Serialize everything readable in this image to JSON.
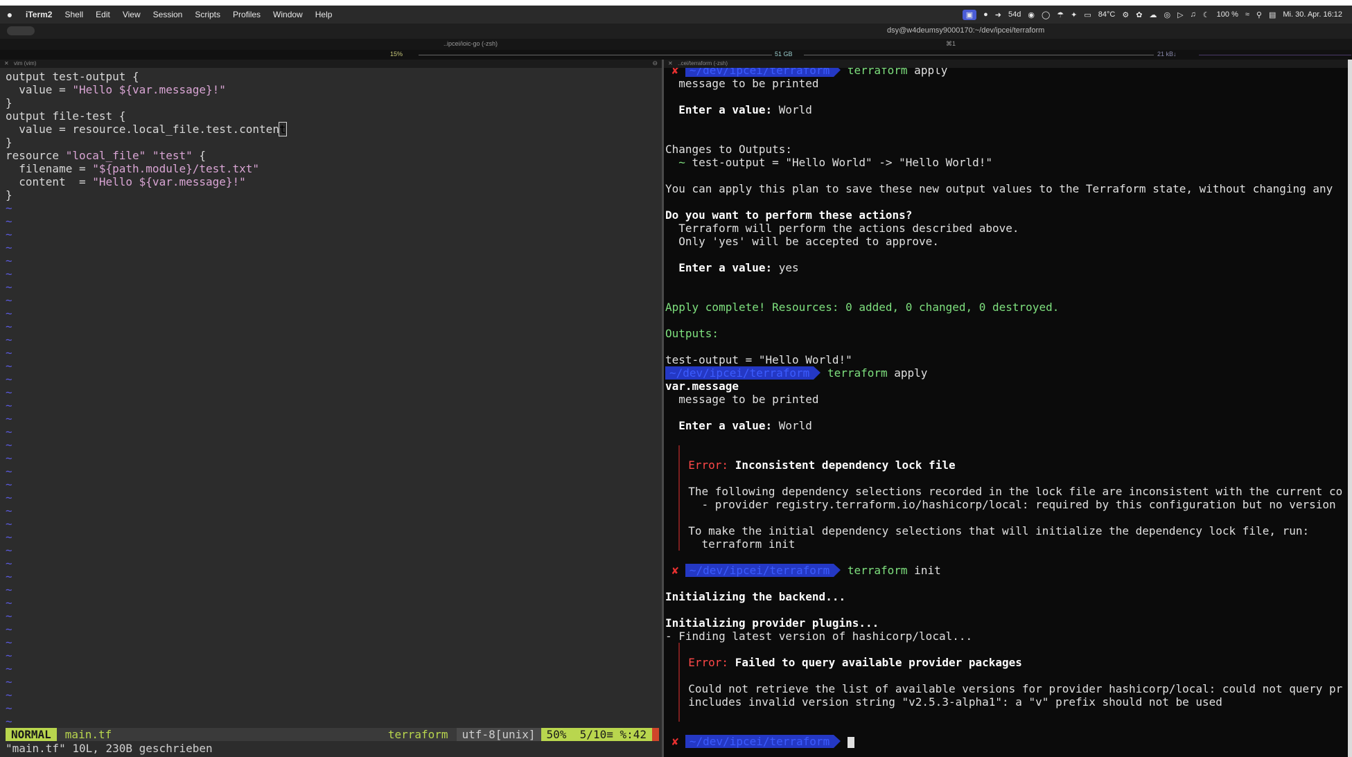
{
  "menubar": {
    "apple": "",
    "items": [
      "iTerm2",
      "Shell",
      "Edit",
      "View",
      "Session",
      "Scripts",
      "Profiles",
      "Window",
      "Help"
    ],
    "status": [
      "54d",
      "84°C",
      "100 %",
      "Mi. 30. Apr.  16:12"
    ]
  },
  "window": {
    "title": "dsy@w4deumsy9000170:~/dev/ipcei/terraform",
    "tab1": "..ipcei/ioic-go (-zsh)",
    "tab_shortcut": "⌘1"
  },
  "statusbar": {
    "cpu": "15%",
    "mem": "51 GB",
    "net": "21 kB↓"
  },
  "left_pane": {
    "header": "vim (vim)",
    "code_lines": [
      [
        {
          "c": "kw",
          "t": "output "
        },
        {
          "c": "ident",
          "t": "test-output {"
        }
      ],
      [
        {
          "c": "plain",
          "t": "  value = "
        },
        {
          "c": "str",
          "t": "\"Hello ${var.message}!\""
        }
      ],
      [
        {
          "c": "plain",
          "t": "}"
        }
      ],
      [
        {
          "c": "kw",
          "t": "output "
        },
        {
          "c": "ident",
          "t": "file-test {"
        }
      ],
      [
        {
          "c": "plain",
          "t": "  value = resource.local_file.test.conten"
        },
        {
          "c": "cursor",
          "t": "t"
        }
      ],
      [
        {
          "c": "plain",
          "t": "}"
        }
      ],
      [
        {
          "c": "kw",
          "t": "resource "
        },
        {
          "c": "str",
          "t": "\"local_file\" \"test\""
        },
        {
          "c": "plain",
          "t": " {"
        }
      ],
      [
        {
          "c": "plain",
          "t": "  filename = "
        },
        {
          "c": "str",
          "t": "\"${path.module}/test.txt\""
        }
      ],
      [
        {
          "c": "plain",
          "t": "  content  = "
        },
        {
          "c": "str",
          "t": "\"Hello ${var.message}!\""
        }
      ],
      [
        {
          "c": "plain",
          "t": "}"
        }
      ]
    ],
    "tilde_count": 41,
    "status": {
      "mode": "NORMAL",
      "file": "main.tf",
      "filetype": "terraform",
      "encoding": "utf-8[unix]",
      "position": "50%  5/10≡ %:42"
    },
    "message": "\"main.tf\" 10L, 230B geschrieben"
  },
  "right_pane": {
    "header": "..cei/terraform (-zsh)",
    "prompt_path": "~/dev/ipcei/terraform",
    "lines": [
      {
        "type": "prompt",
        "x": true,
        "cmd": "terraform",
        "arg": "apply"
      },
      {
        "type": "text",
        "segs": [
          {
            "c": "t-arg",
            "t": "  message to be printed"
          }
        ]
      },
      {
        "type": "blank"
      },
      {
        "type": "text",
        "segs": [
          {
            "c": "t-white",
            "t": "  Enter a value: "
          },
          {
            "c": "t-arg",
            "t": "World"
          }
        ]
      },
      {
        "type": "blank"
      },
      {
        "type": "blank"
      },
      {
        "type": "text",
        "segs": [
          {
            "c": "t-arg",
            "t": "Changes to Outputs:"
          }
        ]
      },
      {
        "type": "text",
        "segs": [
          {
            "c": "t-green",
            "t": "  ~ "
          },
          {
            "c": "t-arg",
            "t": "test-output = \"Hello World\" -> \"Hello World!\""
          }
        ]
      },
      {
        "type": "blank"
      },
      {
        "type": "text",
        "segs": [
          {
            "c": "t-arg",
            "t": "You can apply this plan to save these new output values to the Terraform state, without changing any"
          }
        ]
      },
      {
        "type": "blank"
      },
      {
        "type": "text",
        "segs": [
          {
            "c": "t-white",
            "t": "Do you want to perform these actions?"
          }
        ]
      },
      {
        "type": "text",
        "segs": [
          {
            "c": "t-arg",
            "t": "  Terraform will perform the actions described above."
          }
        ]
      },
      {
        "type": "text",
        "segs": [
          {
            "c": "t-arg",
            "t": "  Only 'yes' will be accepted to approve."
          }
        ]
      },
      {
        "type": "blank"
      },
      {
        "type": "text",
        "segs": [
          {
            "c": "t-white",
            "t": "  Enter a value: "
          },
          {
            "c": "t-arg",
            "t": "yes"
          }
        ]
      },
      {
        "type": "blank"
      },
      {
        "type": "blank"
      },
      {
        "type": "text",
        "segs": [
          {
            "c": "t-green",
            "t": "Apply complete! Resources: 0 added, 0 changed, 0 destroyed."
          }
        ]
      },
      {
        "type": "blank"
      },
      {
        "type": "text",
        "segs": [
          {
            "c": "t-green",
            "t": "Outputs:"
          }
        ]
      },
      {
        "type": "blank"
      },
      {
        "type": "text",
        "segs": [
          {
            "c": "t-arg",
            "t": "test-output = \"Hello World!\""
          }
        ]
      },
      {
        "type": "prompt",
        "x": false,
        "cmd": "terraform",
        "arg": "apply"
      },
      {
        "type": "text",
        "segs": [
          {
            "c": "t-white",
            "t": "var.message"
          }
        ]
      },
      {
        "type": "text",
        "segs": [
          {
            "c": "t-arg",
            "t": "  message to be printed"
          }
        ]
      },
      {
        "type": "blank"
      },
      {
        "type": "text",
        "segs": [
          {
            "c": "t-white",
            "t": "  Enter a value: "
          },
          {
            "c": "t-arg",
            "t": "World"
          }
        ]
      },
      {
        "type": "blank"
      },
      {
        "type": "err",
        "segs": []
      },
      {
        "type": "err",
        "segs": [
          {
            "c": "t-red",
            "t": "Error: "
          },
          {
            "c": "t-white",
            "t": "Inconsistent dependency lock file"
          }
        ]
      },
      {
        "type": "err",
        "segs": []
      },
      {
        "type": "err",
        "segs": [
          {
            "c": "t-arg",
            "t": "The following dependency selections recorded in the lock file are inconsistent with the current co"
          }
        ]
      },
      {
        "type": "err",
        "segs": [
          {
            "c": "t-arg",
            "t": "  - provider registry.terraform.io/hashicorp/local: required by this configuration but no version"
          }
        ]
      },
      {
        "type": "err",
        "segs": []
      },
      {
        "type": "err",
        "segs": [
          {
            "c": "t-arg",
            "t": "To make the initial dependency selections that will initialize the dependency lock file, run:"
          }
        ]
      },
      {
        "type": "err",
        "segs": [
          {
            "c": "t-arg",
            "t": "  terraform init"
          }
        ]
      },
      {
        "type": "blank"
      },
      {
        "type": "prompt",
        "x": true,
        "cmd": "terraform",
        "arg": "init"
      },
      {
        "type": "blank"
      },
      {
        "type": "text",
        "segs": [
          {
            "c": "t-white",
            "t": "Initializing the backend..."
          }
        ]
      },
      {
        "type": "blank"
      },
      {
        "type": "text",
        "segs": [
          {
            "c": "t-white",
            "t": "Initializing provider plugins..."
          }
        ]
      },
      {
        "type": "text",
        "segs": [
          {
            "c": "t-arg",
            "t": "- Finding latest version of hashicorp/local..."
          }
        ]
      },
      {
        "type": "err",
        "segs": []
      },
      {
        "type": "err",
        "segs": [
          {
            "c": "t-red",
            "t": "Error: "
          },
          {
            "c": "t-white",
            "t": "Failed to query available provider packages"
          }
        ]
      },
      {
        "type": "err",
        "segs": []
      },
      {
        "type": "err",
        "segs": [
          {
            "c": "t-arg",
            "t": "Could not retrieve the list of available versions for provider hashicorp/local: could not query pr"
          }
        ]
      },
      {
        "type": "err",
        "segs": [
          {
            "c": "t-arg",
            "t": "includes invalid version string \"v2.5.3-alpha1\": a \"v\" prefix should not be used"
          }
        ]
      },
      {
        "type": "err",
        "segs": []
      },
      {
        "type": "blank"
      },
      {
        "type": "prompt",
        "x": true,
        "cmd": "",
        "arg": "",
        "caret": true
      }
    ]
  }
}
